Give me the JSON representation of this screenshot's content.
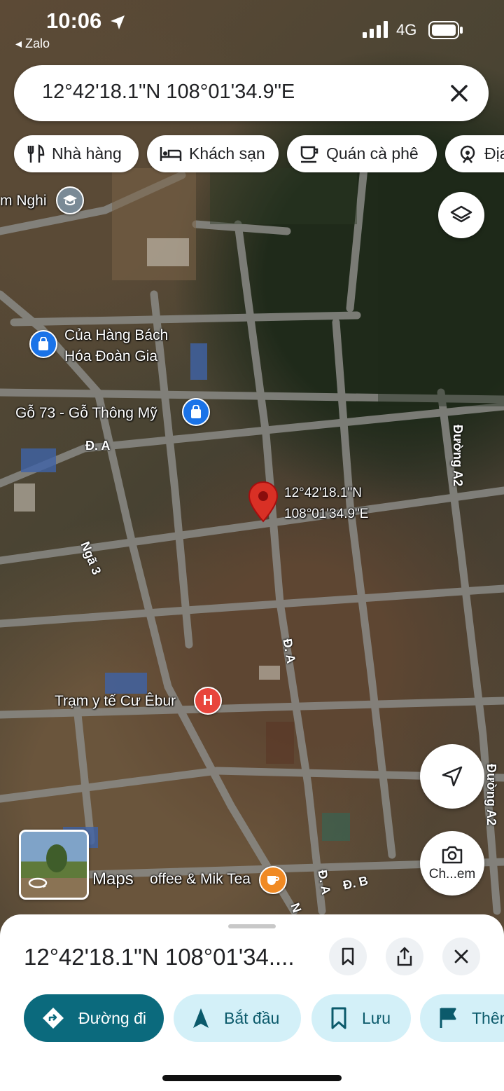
{
  "status_bar": {
    "time": "10:06",
    "back_app": "◂ Zalo",
    "network": "4G"
  },
  "search": {
    "query": "12°42'18.1\"N 108°01'34.9\"E"
  },
  "chips": [
    {
      "label": "Nhà hàng",
      "icon": "restaurant-icon"
    },
    {
      "label": "Khách sạn",
      "icon": "hotel-icon"
    },
    {
      "label": "Quán cà phê",
      "icon": "coffee-icon"
    },
    {
      "label": "Địa",
      "icon": "attraction-icon"
    }
  ],
  "map": {
    "pin_label_lat": "12°42'18.1\"N",
    "pin_label_lng": "108°01'34.9\"E",
    "pois": [
      {
        "name": "m Nghi",
        "icon": "school-icon"
      },
      {
        "name_line1": "Của Hàng Bách",
        "name_line2": "Hóa Đoàn Gia",
        "icon": "shopping-icon"
      },
      {
        "name": "Gỗ 73 - Gỗ Thông Mỹ",
        "icon": "shopping-icon"
      },
      {
        "name": "Trạm y tế Cư Êbur",
        "icon": "hospital-icon"
      },
      {
        "name": "offee & Mik Tea",
        "icon": "cafe-icon"
      }
    ],
    "roads": [
      "Đ. A",
      "Ngã 3",
      "Đường A2",
      "Đ. A",
      "Đường A2",
      "Đ. A",
      "Đ. B",
      "N"
    ],
    "watermark": "Maps",
    "street_view_label": "Ch...em"
  },
  "sheet": {
    "title": "12°42'18.1\"N 108°01'34....",
    "actions": [
      {
        "label": "Đường đi",
        "icon": "directions-icon"
      },
      {
        "label": "Bắt đầu",
        "icon": "navigation-icon"
      },
      {
        "label": "Lưu",
        "icon": "bookmark-icon"
      },
      {
        "label": "Thêm",
        "icon": "flag-icon"
      }
    ]
  },
  "colors": {
    "primary": "#0b6a7d",
    "chip_bg": "#d3f0f8",
    "pin": "#d93025"
  }
}
